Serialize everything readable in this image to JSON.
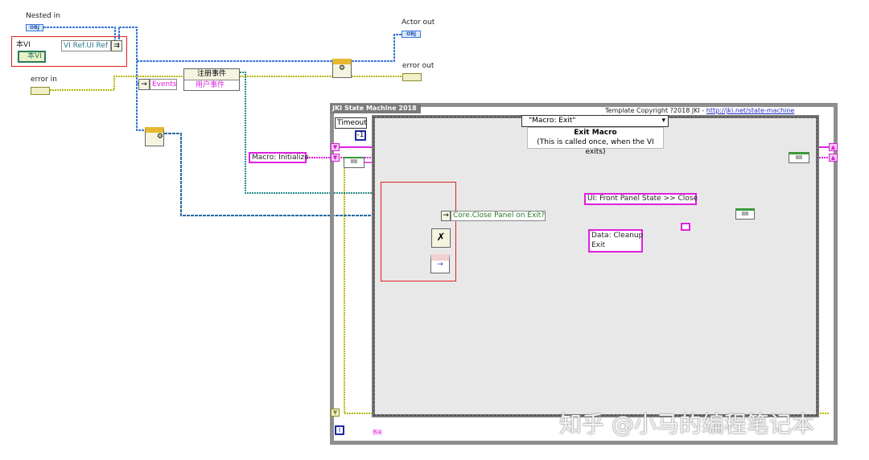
{
  "diagram": {
    "controls": {
      "nested_in": {
        "label": "Nested in",
        "terminal": "OBJ"
      },
      "this_vi_label": "本VI",
      "this_vi_ref": "本VI",
      "vi_ref_prop": "VI Ref.UI Ref",
      "error_in": {
        "label": "error in"
      }
    },
    "indicators": {
      "actor_out": {
        "label": "Actor out",
        "terminal": "OBJ"
      },
      "error_out": {
        "label": "error out"
      }
    },
    "register_events": {
      "bundle_label": "Events",
      "node_title": "注册事件",
      "node_item": "用户事件"
    },
    "macro_initialize": "Macro: Initialize",
    "while_loop": {
      "title": "JKI State Machine 2018",
      "copyright": "Template Copyright ?2018 JKI - ",
      "link": "http://jki.net/state-machine",
      "timeout_label": "Timeout",
      "timeout_value": "-1",
      "iteration_icon": "i",
      "bottom_tag": "R-a"
    },
    "case_structure": {
      "selector": "\"Macro: Exit\"",
      "comment_title": "Exit Macro",
      "comment_body": "(This is called once, when the VI exits)",
      "core_close_panel": "Core.Close Panel on Exit?",
      "ui_front_panel": "UI: Front Panel State >> Close",
      "data_cleanup": "Data: Cleanup\nExit"
    },
    "colors": {
      "error_wire": "#b8b800",
      "object_wire": "#3a78d6",
      "string_wire": "#e020e0",
      "ref_wire": "#2a8a8a",
      "highlight_box": "#e02020"
    },
    "watermark": "知乎 @小马的编程笔记本"
  }
}
